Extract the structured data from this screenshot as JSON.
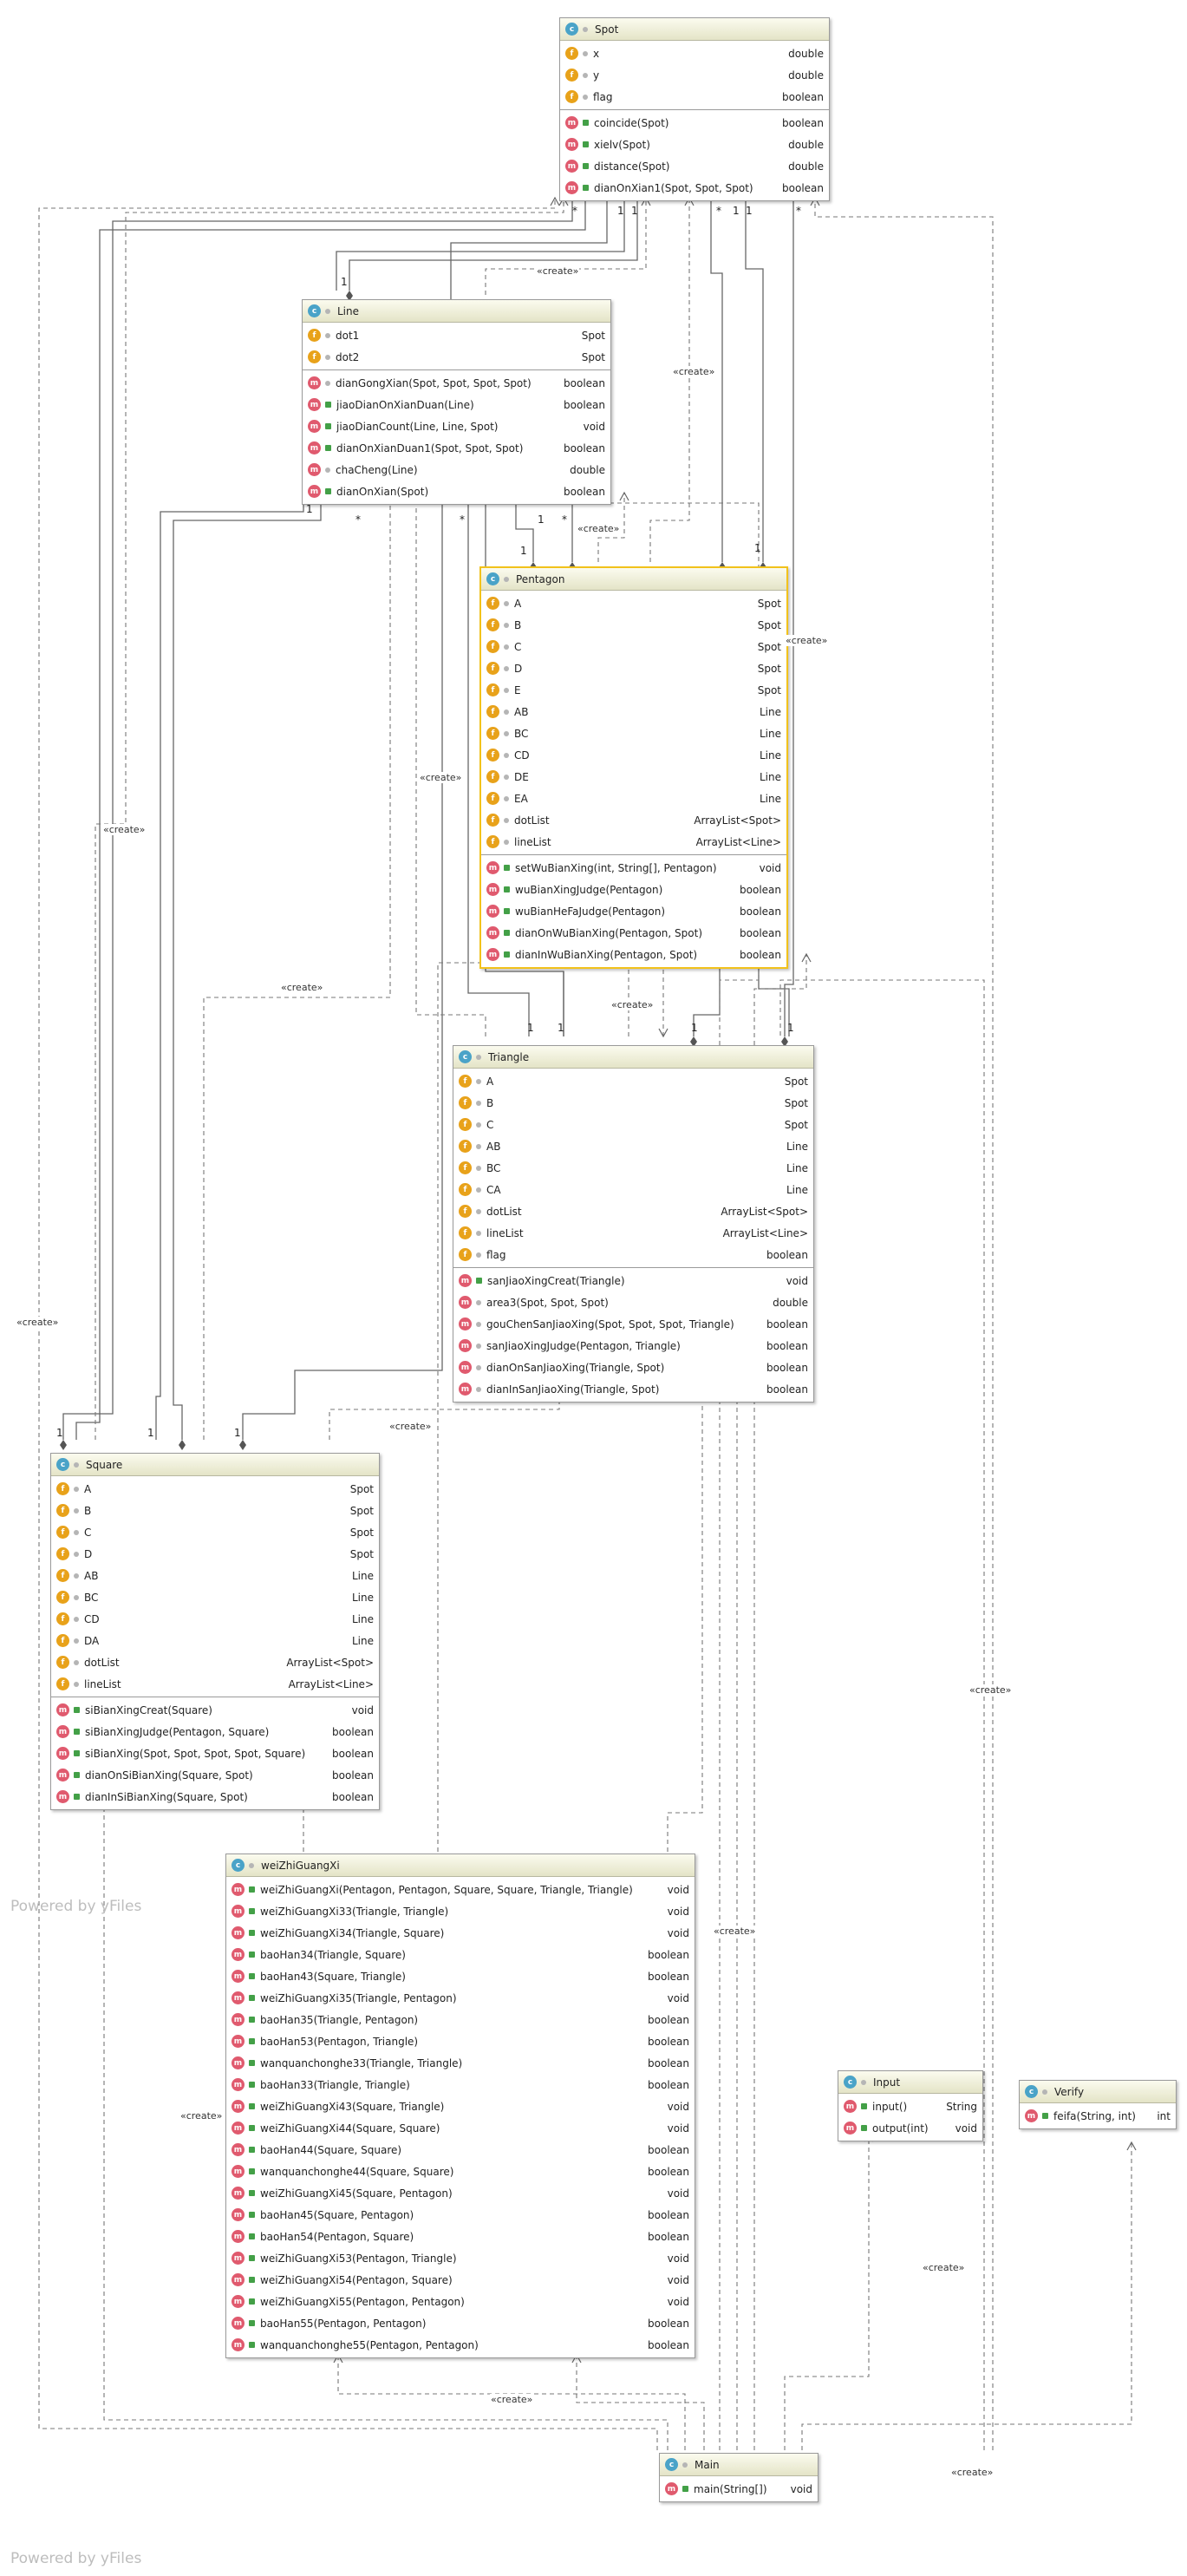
{
  "classes": {
    "spot": {
      "name": "Spot",
      "fields": [
        {
          "name": "x",
          "type": "double"
        },
        {
          "name": "y",
          "type": "double"
        },
        {
          "name": "flag",
          "type": "boolean"
        }
      ],
      "methods": [
        {
          "name": "coincide(Spot)",
          "type": "boolean"
        },
        {
          "name": "xielv(Spot)",
          "type": "double"
        },
        {
          "name": "distance(Spot)",
          "type": "double"
        },
        {
          "name": "dianOnXian1(Spot, Spot, Spot)",
          "type": "boolean"
        }
      ]
    },
    "line": {
      "name": "Line",
      "fields": [
        {
          "name": "dot1",
          "type": "Spot"
        },
        {
          "name": "dot2",
          "type": "Spot"
        }
      ],
      "methods": [
        {
          "name": "dianGongXian(Spot, Spot, Spot, Spot)",
          "type": "boolean"
        },
        {
          "name": "jiaoDianOnXianDuan(Line)",
          "type": "boolean"
        },
        {
          "name": "jiaoDianCount(Line, Line, Spot)",
          "type": "void"
        },
        {
          "name": "dianOnXianDuan1(Spot, Spot, Spot)",
          "type": "boolean"
        },
        {
          "name": "chaCheng(Line)",
          "type": "double"
        },
        {
          "name": "dianOnXian(Spot)",
          "type": "boolean"
        }
      ]
    },
    "pentagon": {
      "name": "Pentagon",
      "fields": [
        {
          "name": "A",
          "type": "Spot"
        },
        {
          "name": "B",
          "type": "Spot"
        },
        {
          "name": "C",
          "type": "Spot"
        },
        {
          "name": "D",
          "type": "Spot"
        },
        {
          "name": "E",
          "type": "Spot"
        },
        {
          "name": "AB",
          "type": "Line"
        },
        {
          "name": "BC",
          "type": "Line"
        },
        {
          "name": "CD",
          "type": "Line"
        },
        {
          "name": "DE",
          "type": "Line"
        },
        {
          "name": "EA",
          "type": "Line"
        },
        {
          "name": "dotList",
          "type": "ArrayList<Spot>"
        },
        {
          "name": "lineList",
          "type": "ArrayList<Line>"
        }
      ],
      "methods": [
        {
          "name": "setWuBianXing(int, String[], Pentagon)",
          "type": "void"
        },
        {
          "name": "wuBianXingJudge(Pentagon)",
          "type": "boolean"
        },
        {
          "name": "wuBianHeFaJudge(Pentagon)",
          "type": "boolean"
        },
        {
          "name": "dianOnWuBianXing(Pentagon, Spot)",
          "type": "boolean"
        },
        {
          "name": "dianInWuBianXing(Pentagon, Spot)",
          "type": "boolean"
        }
      ]
    },
    "triangle": {
      "name": "Triangle",
      "fields": [
        {
          "name": "A",
          "type": "Spot"
        },
        {
          "name": "B",
          "type": "Spot"
        },
        {
          "name": "C",
          "type": "Spot"
        },
        {
          "name": "AB",
          "type": "Line"
        },
        {
          "name": "BC",
          "type": "Line"
        },
        {
          "name": "CA",
          "type": "Line"
        },
        {
          "name": "dotList",
          "type": "ArrayList<Spot>"
        },
        {
          "name": "lineList",
          "type": "ArrayList<Line>"
        },
        {
          "name": "flag",
          "type": "boolean"
        }
      ],
      "methods": [
        {
          "name": "sanJiaoXingCreat(Triangle)",
          "type": "void"
        },
        {
          "name": "area3(Spot, Spot, Spot)",
          "type": "double"
        },
        {
          "name": "gouChenSanJiaoXing(Spot, Spot, Spot, Triangle)",
          "type": "boolean"
        },
        {
          "name": "sanJiaoXingJudge(Pentagon, Triangle)",
          "type": "boolean"
        },
        {
          "name": "dianOnSanJiaoXing(Triangle, Spot)",
          "type": "boolean"
        },
        {
          "name": "dianInSanJiaoXing(Triangle, Spot)",
          "type": "boolean"
        }
      ]
    },
    "square": {
      "name": "Square",
      "fields": [
        {
          "name": "A",
          "type": "Spot"
        },
        {
          "name": "B",
          "type": "Spot"
        },
        {
          "name": "C",
          "type": "Spot"
        },
        {
          "name": "D",
          "type": "Spot"
        },
        {
          "name": "AB",
          "type": "Line"
        },
        {
          "name": "BC",
          "type": "Line"
        },
        {
          "name": "CD",
          "type": "Line"
        },
        {
          "name": "DA",
          "type": "Line"
        },
        {
          "name": "dotList",
          "type": "ArrayList<Spot>"
        },
        {
          "name": "lineList",
          "type": "ArrayList<Line>"
        }
      ],
      "methods": [
        {
          "name": "siBianXingCreat(Square)",
          "type": "void"
        },
        {
          "name": "siBianXingJudge(Pentagon, Square)",
          "type": "boolean"
        },
        {
          "name": "siBianXing(Spot, Spot, Spot, Spot, Square)",
          "type": "boolean"
        },
        {
          "name": "dianOnSiBianXing(Square, Spot)",
          "type": "boolean"
        },
        {
          "name": "dianInSiBianXing(Square, Spot)",
          "type": "boolean"
        }
      ]
    },
    "weizhi": {
      "name": "weiZhiGuangXi",
      "fields": [],
      "methods": [
        {
          "name": "weiZhiGuangXi(Pentagon, Pentagon, Square, Square, Triangle, Triangle)",
          "type": "void"
        },
        {
          "name": "weiZhiGuangXi33(Triangle, Triangle)",
          "type": "void"
        },
        {
          "name": "weiZhiGuangXi34(Triangle, Square)",
          "type": "void"
        },
        {
          "name": "baoHan34(Triangle, Square)",
          "type": "boolean"
        },
        {
          "name": "baoHan43(Square, Triangle)",
          "type": "boolean"
        },
        {
          "name": "weiZhiGuangXi35(Triangle, Pentagon)",
          "type": "void"
        },
        {
          "name": "baoHan35(Triangle, Pentagon)",
          "type": "boolean"
        },
        {
          "name": "baoHan53(Pentagon, Triangle)",
          "type": "boolean"
        },
        {
          "name": "wanquanchonghe33(Triangle, Triangle)",
          "type": "boolean"
        },
        {
          "name": "baoHan33(Triangle, Triangle)",
          "type": "boolean"
        },
        {
          "name": "weiZhiGuangXi43(Square, Triangle)",
          "type": "void"
        },
        {
          "name": "weiZhiGuangXi44(Square, Square)",
          "type": "void"
        },
        {
          "name": "baoHan44(Square, Square)",
          "type": "boolean"
        },
        {
          "name": "wanquanchonghe44(Square, Square)",
          "type": "boolean"
        },
        {
          "name": "weiZhiGuangXi45(Square, Pentagon)",
          "type": "void"
        },
        {
          "name": "baoHan45(Square, Pentagon)",
          "type": "boolean"
        },
        {
          "name": "baoHan54(Pentagon, Square)",
          "type": "boolean"
        },
        {
          "name": "weiZhiGuangXi53(Pentagon, Triangle)",
          "type": "void"
        },
        {
          "name": "weiZhiGuangXi54(Pentagon, Square)",
          "type": "void"
        },
        {
          "name": "weiZhiGuangXi55(Pentagon, Pentagon)",
          "type": "void"
        },
        {
          "name": "baoHan55(Pentagon, Pentagon)",
          "type": "boolean"
        },
        {
          "name": "wanquanchonghe55(Pentagon, Pentagon)",
          "type": "boolean"
        }
      ]
    },
    "input": {
      "name": "Input",
      "fields": [],
      "methods": [
        {
          "name": "input()",
          "type": "String"
        },
        {
          "name": "output(int)",
          "type": "void"
        }
      ]
    },
    "verify": {
      "name": "Verify",
      "fields": [],
      "methods": [
        {
          "name": "feifa(String, int)",
          "type": "int"
        }
      ]
    },
    "main": {
      "name": "Main",
      "fields": [],
      "methods": [
        {
          "name": "main(String[])",
          "type": "void"
        }
      ]
    }
  },
  "labels": {
    "create": "«create»",
    "one": "1",
    "many": "*"
  },
  "watermark": "Powered by yFiles",
  "colors": {
    "class_badge": "#4aa3c8",
    "field_badge": "#e8a21a",
    "method_badge": "#e05a6e",
    "selected_border": "#f2c21b",
    "header_bg": "#eeeed6"
  }
}
